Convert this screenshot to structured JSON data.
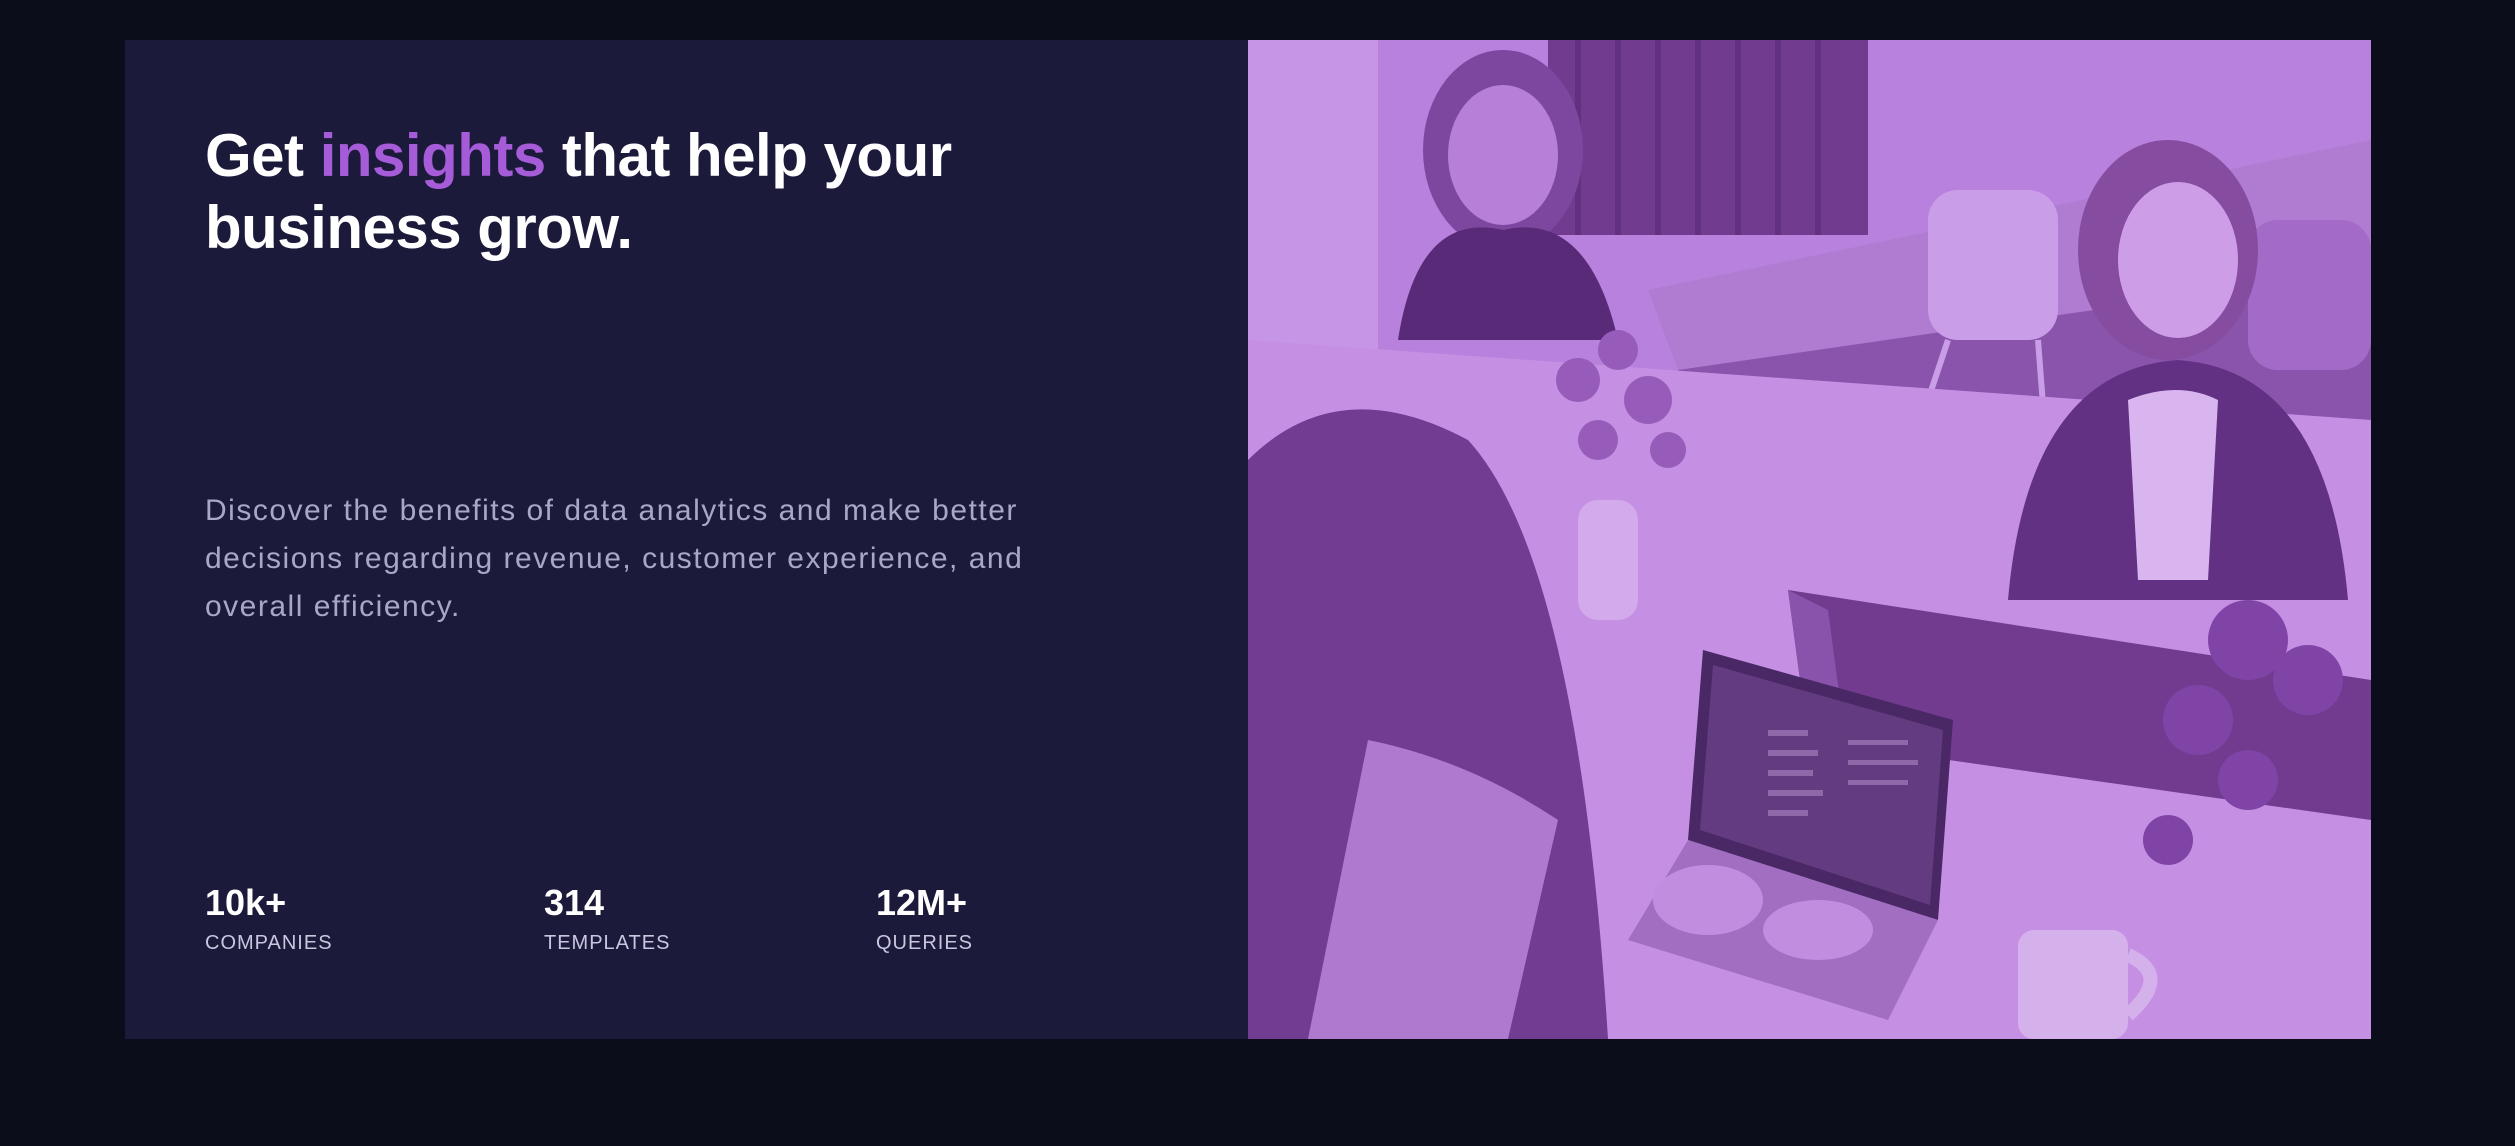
{
  "hero": {
    "headline_part1": "Get",
    "headline_accent": "insights",
    "headline_part2": "that help your business grow.",
    "description": "Discover the benefits of data analytics and make better decisions regarding revenue, customer experience, and overall efficiency.",
    "accent_color": "#a65cd8"
  },
  "stats": [
    {
      "value": "10k+",
      "label": "COMPANIES"
    },
    {
      "value": "314",
      "label": "TEMPLATES"
    },
    {
      "value": "12M+",
      "label": "QUERIES"
    }
  ],
  "image": {
    "alt": "Team members working at a table with laptop and flowers",
    "tint_color": "#b886dc"
  }
}
